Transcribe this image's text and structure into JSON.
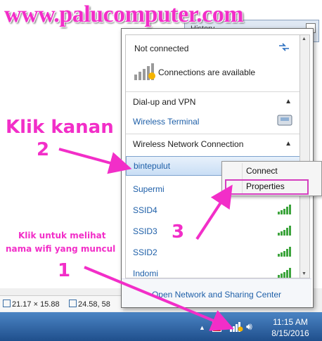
{
  "watermark": "www.palucomputer.com",
  "background": {
    "window_title": "History"
  },
  "flyout": {
    "status": {
      "title": "Not connected",
      "sub": "Connections are available"
    },
    "sections": [
      {
        "header": "Dial-up and VPN",
        "items": [
          "Wireless Terminal"
        ]
      },
      {
        "header": "Wireless Network Connection"
      }
    ],
    "networks": [
      "bintepulut",
      "Supermi",
      "SSID4",
      "SSID3",
      "SSID2",
      "Indomi"
    ],
    "footer_link": "Open Network and Sharing Center"
  },
  "context_menu": {
    "items": [
      "Connect",
      "Properties"
    ]
  },
  "annotations": {
    "klik_kanan": "Klik kanan",
    "step1": "1",
    "step2": "2",
    "step3": "3",
    "hint_line1": "Klik untuk melihat",
    "hint_line2": "nama wifi yang muncul"
  },
  "statusbar": {
    "size1": "21.17 × 15.88",
    "size2": "24.58, 58"
  },
  "taskbar": {
    "time": "11:15 AM",
    "date": "8/15/2016"
  },
  "colors": {
    "annotation": "#f22ec8",
    "link": "#1e5fa8",
    "taskbar": "#2a5fa0",
    "signal": "#3ca43c"
  }
}
